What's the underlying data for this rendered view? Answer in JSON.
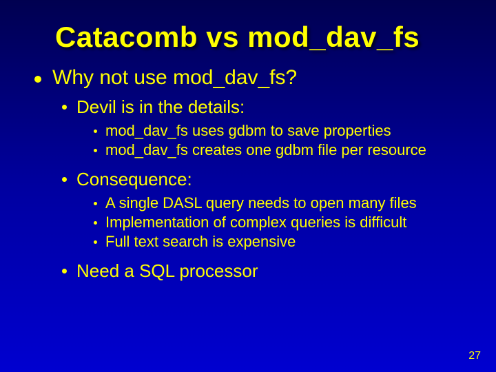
{
  "title": "Catacomb vs mod_dav_fs",
  "level1": {
    "text": "Why not use mod_dav_fs?"
  },
  "section1": {
    "heading": "Devil is in the details:",
    "items": [
      "mod_dav_fs uses gdbm to save properties",
      "mod_dav_fs creates one gdbm file per resource"
    ]
  },
  "section2": {
    "heading": "Consequence:",
    "items": [
      "A single DASL query needs to open many files",
      "Implementation of complex queries is difficult",
      "Full text search is expensive"
    ]
  },
  "section3": {
    "heading": "Need a SQL processor"
  },
  "page_number": "27"
}
